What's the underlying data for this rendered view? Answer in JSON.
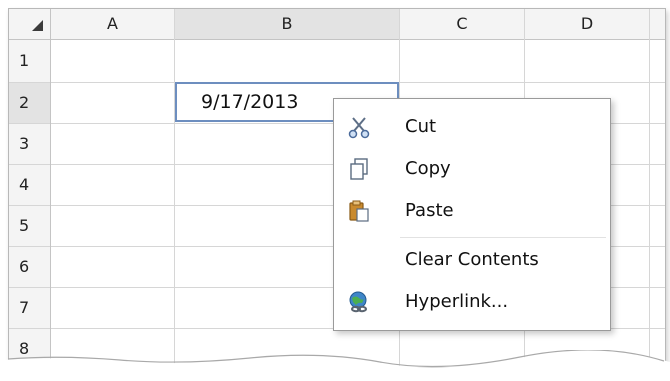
{
  "columns": [
    "A",
    "B",
    "C",
    "D"
  ],
  "rows": [
    "1",
    "2",
    "3",
    "4",
    "5",
    "6",
    "7",
    "8"
  ],
  "selected_cell": {
    "column": "B",
    "row": "2",
    "value": "9/17/2013"
  },
  "context_menu": {
    "items": [
      {
        "label": "Cut",
        "icon": "scissors-icon"
      },
      {
        "label": "Copy",
        "icon": "copy-icon"
      },
      {
        "label": "Paste",
        "icon": "paste-icon"
      },
      {
        "label": "Clear Contents",
        "icon": ""
      },
      {
        "label": "Hyperlink...",
        "icon": "hyperlink-globe-icon"
      }
    ]
  },
  "colors": {
    "selection_border": "#6d8ebf",
    "header_bg": "#f4f4f4",
    "selected_header_bg": "#e3e3e3",
    "grid": "#d6d6d6"
  }
}
